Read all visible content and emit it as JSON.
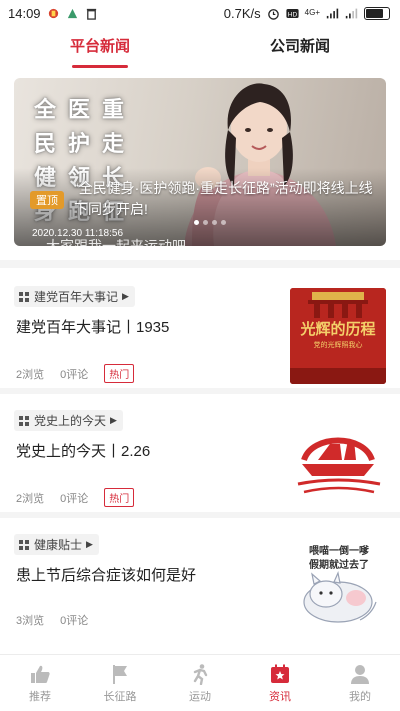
{
  "status_bar": {
    "time": "14:09",
    "speed": "0.7K/s",
    "network": "4G+",
    "battery_level": 0.78
  },
  "tabs": [
    {
      "label": "平台新闻",
      "active": true
    },
    {
      "label": "公司新闻",
      "active": false
    }
  ],
  "banner": {
    "slogan": [
      "全",
      "医",
      "重",
      "民",
      "护",
      "走",
      "健",
      "领",
      "长",
      "身",
      "跑",
      "征"
    ],
    "badge": "置顶",
    "headline": "“全民健身·医护领跑·重走长征路”活动即将线上线下同步开启!",
    "date": "2020.12.30 11:18:56",
    "subtitle": "大家跟我一起来运动吧"
  },
  "news": [
    {
      "category": "建党百年大事记",
      "title": "建党百年大事记丨1935",
      "views": "2浏览",
      "comments": "0评论",
      "tag": "热门",
      "thumb_text": "光辉的历程",
      "thumb_sub": "党的光辉照我心"
    },
    {
      "category": "党史上的今天",
      "title": "党史上的今天丨2.26",
      "views": "2浏览",
      "comments": "0评论",
      "tag": "热门"
    },
    {
      "category": "健康贴士",
      "title": "患上节后综合症该如何是好",
      "views": "3浏览",
      "comments": "0评论",
      "thumb_text": "喂喵一倒一嗲",
      "thumb_sub": "假期就过去了"
    }
  ],
  "bottom_nav": [
    {
      "label": "推荐",
      "icon": "thumbs-up-icon",
      "active": false
    },
    {
      "label": "长征路",
      "icon": "flag-icon",
      "active": false
    },
    {
      "label": "运动",
      "icon": "running-icon",
      "active": false
    },
    {
      "label": "资讯",
      "icon": "news-calendar-icon",
      "active": true
    },
    {
      "label": "我的",
      "icon": "user-icon",
      "active": false
    }
  ],
  "colors": {
    "accent": "#d62b3a",
    "badge": "#e39a2a",
    "inactive": "#999999"
  }
}
